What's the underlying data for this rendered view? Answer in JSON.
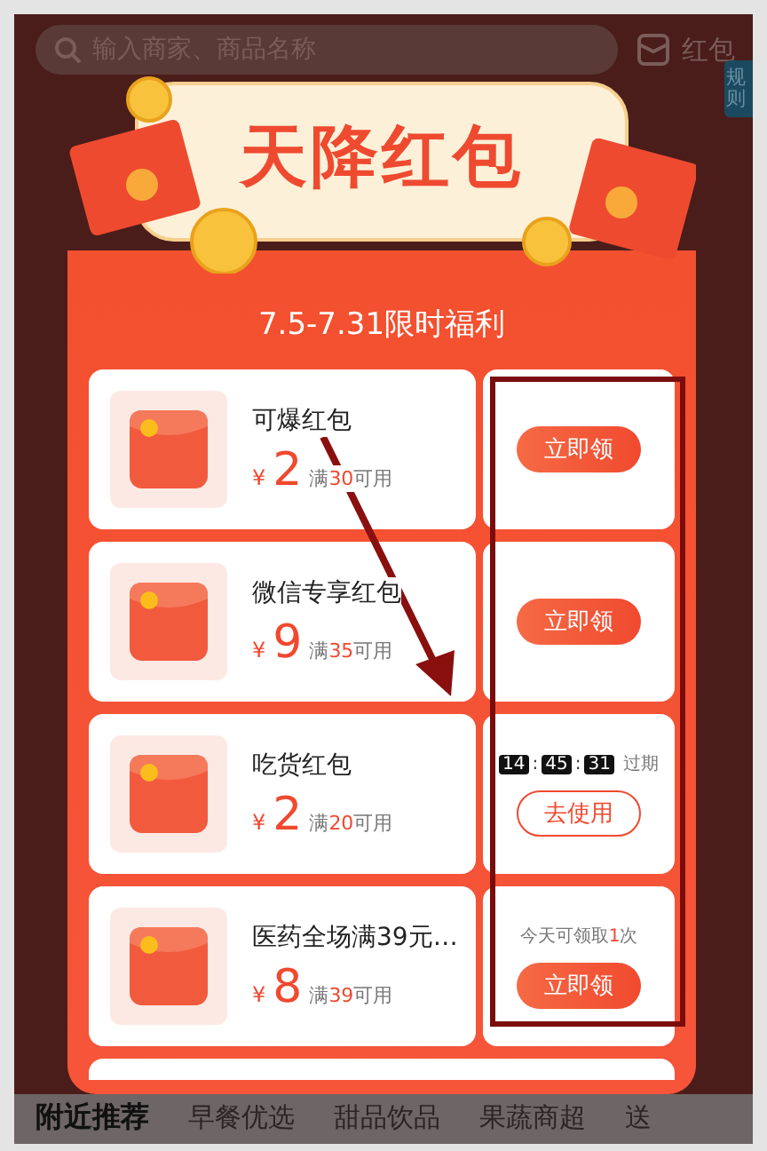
{
  "background_page": {
    "search": {
      "placeholder": "输入商家、商品名称"
    },
    "red_packet_link": "红包",
    "rules_tab": "规则",
    "category_tabs": [
      {
        "label": "附近推荐",
        "selected": true
      },
      {
        "label": "早餐优选",
        "selected": false
      },
      {
        "label": "甜品饮品",
        "selected": false
      },
      {
        "label": "果蔬商超",
        "selected": false
      },
      {
        "label": "送",
        "selected": false
      }
    ]
  },
  "popup": {
    "title": "天降红包",
    "subtitle": "7.5-7.31限时福利",
    "coupons": [
      {
        "kind": "claim",
        "name": "可爆红包",
        "currency": "¥",
        "amount": "2",
        "condition": [
          "满",
          "30",
          "可用"
        ],
        "button": "立即领"
      },
      {
        "kind": "claim",
        "name": "微信专享红包",
        "currency": "¥",
        "amount": "9",
        "condition": [
          "满",
          "35",
          "可用"
        ],
        "button": "立即领"
      },
      {
        "kind": "countdown",
        "name": "吃货红包",
        "currency": "¥",
        "amount": "2",
        "condition": [
          "满",
          "20",
          "可用"
        ],
        "timer": {
          "digits": [
            "14",
            "45",
            "31"
          ],
          "separators": [
            ":",
            ":"
          ],
          "label": "过期"
        },
        "button": "去使用"
      },
      {
        "kind": "limited",
        "name": "医药全场满39元…",
        "currency": "¥",
        "amount": "8",
        "condition": [
          "满",
          "39",
          "可用"
        ],
        "note": [
          "今天可领取",
          "1",
          "次"
        ],
        "button": "立即领"
      }
    ]
  }
}
